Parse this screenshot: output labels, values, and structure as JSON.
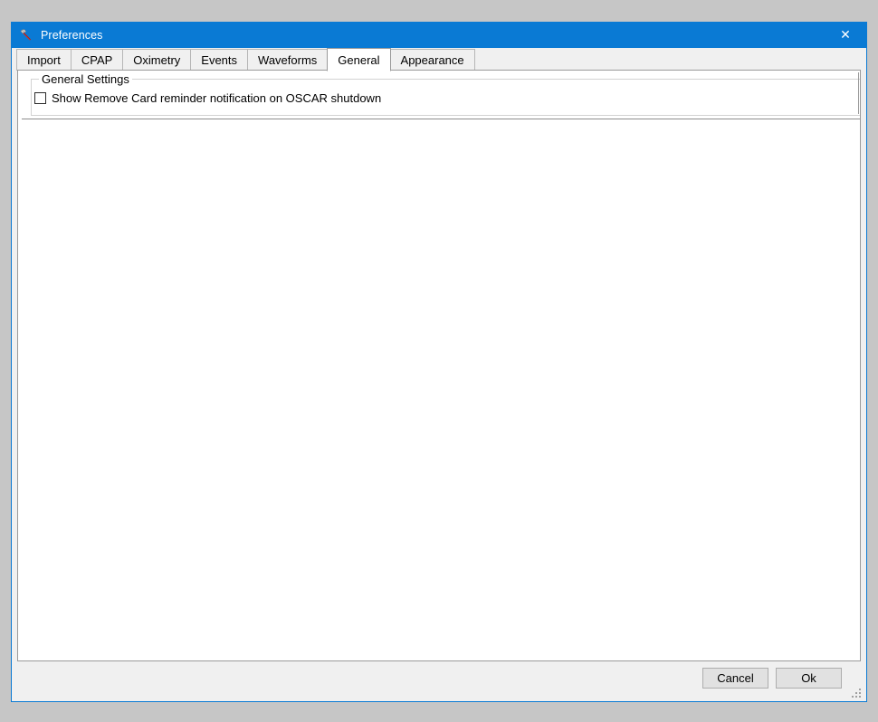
{
  "window": {
    "title": "Preferences",
    "icon": "wrench-icon",
    "close_label": "✕",
    "accent_color": "#0a7ad4"
  },
  "tabs": [
    {
      "label": "Import",
      "selected": false
    },
    {
      "label": "CPAP",
      "selected": false
    },
    {
      "label": "Oximetry",
      "selected": false
    },
    {
      "label": "Events",
      "selected": false
    },
    {
      "label": "Waveforms",
      "selected": false
    },
    {
      "label": "General",
      "selected": true
    },
    {
      "label": "Appearance",
      "selected": false
    }
  ],
  "general_tab": {
    "groupbox": {
      "legend": "General Settings",
      "options": [
        {
          "label": "Show Remove Card reminder notification on OSCAR shutdown",
          "checked": false
        }
      ]
    }
  },
  "footer": {
    "cancel_label": "Cancel",
    "ok_label": "Ok"
  }
}
